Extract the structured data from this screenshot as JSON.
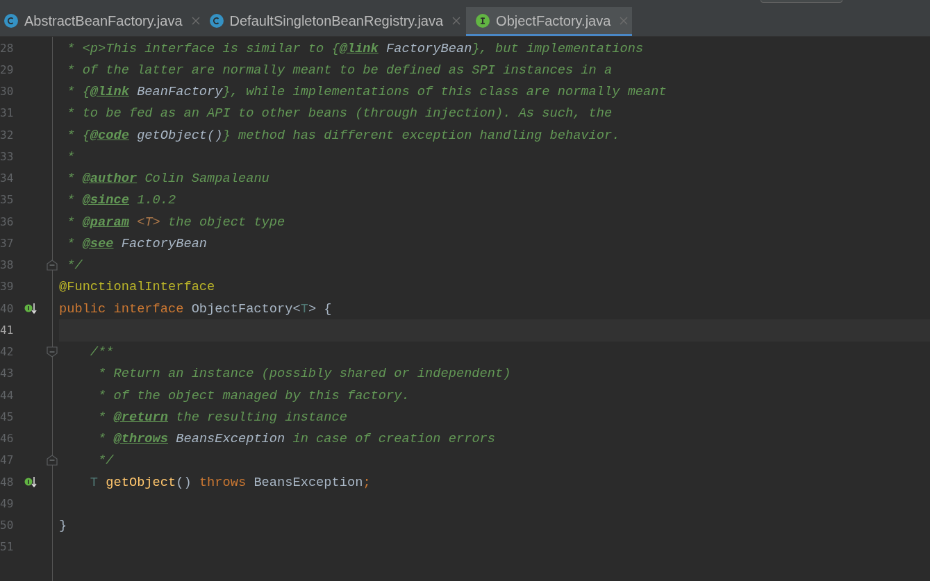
{
  "tabs": [
    {
      "label": "AbstractBeanFactory.java",
      "kind": "class",
      "selected": false
    },
    {
      "label": "DefaultSingletonBeanRegistry.java",
      "kind": "class",
      "selected": false
    },
    {
      "label": "ObjectFactory.java",
      "kind": "interface",
      "selected": true
    }
  ],
  "editor": {
    "lines": [
      {
        "number": "28",
        "current": false,
        "tokens": [
          {
            "kind": "comment",
            "text": " * <p>This interface is similar to {"
          },
          {
            "kind": "tag",
            "text": "@link"
          },
          {
            "kind": "ref",
            "text": " FactoryBean"
          },
          {
            "kind": "comment",
            "text": "}, but implementations"
          }
        ]
      },
      {
        "number": "29",
        "current": false,
        "tokens": [
          {
            "kind": "comment",
            "text": " * of the latter are normally meant to be defined as SPI instances in a"
          }
        ]
      },
      {
        "number": "30",
        "current": false,
        "tokens": [
          {
            "kind": "comment",
            "text": " * {"
          },
          {
            "kind": "tag",
            "text": "@link"
          },
          {
            "kind": "ref",
            "text": " BeanFactory"
          },
          {
            "kind": "comment",
            "text": "}, while implementations of this class are normally meant"
          }
        ]
      },
      {
        "number": "31",
        "current": false,
        "tokens": [
          {
            "kind": "comment",
            "text": " * to be fed as an API to other beans (through injection). As such, the"
          }
        ]
      },
      {
        "number": "32",
        "current": false,
        "tokens": [
          {
            "kind": "comment",
            "text": " * {"
          },
          {
            "kind": "tag",
            "text": "@code"
          },
          {
            "kind": "ref",
            "text": " getObject()"
          },
          {
            "kind": "comment",
            "text": "} method has different exception handling behavior."
          }
        ]
      },
      {
        "number": "33",
        "current": false,
        "tokens": [
          {
            "kind": "comment",
            "text": " *"
          }
        ]
      },
      {
        "number": "34",
        "current": false,
        "tokens": [
          {
            "kind": "comment",
            "text": " * "
          },
          {
            "kind": "tag",
            "text": "@author"
          },
          {
            "kind": "comment",
            "text": " Colin Sampaleanu"
          }
        ]
      },
      {
        "number": "35",
        "current": false,
        "tokens": [
          {
            "kind": "comment",
            "text": " * "
          },
          {
            "kind": "tag",
            "text": "@since"
          },
          {
            "kind": "comment",
            "text": " 1.0.2"
          }
        ]
      },
      {
        "number": "36",
        "current": false,
        "tokens": [
          {
            "kind": "comment",
            "text": " * "
          },
          {
            "kind": "tag",
            "text": "@param"
          },
          {
            "kind": "docparam",
            "text": " <T>"
          },
          {
            "kind": "comment",
            "text": " the object type"
          }
        ]
      },
      {
        "number": "37",
        "current": false,
        "tokens": [
          {
            "kind": "comment",
            "text": " * "
          },
          {
            "kind": "tag",
            "text": "@see"
          },
          {
            "kind": "ref",
            "text": " FactoryBean"
          }
        ]
      },
      {
        "number": "38",
        "current": false,
        "gutter": {
          "kind": "fold-end"
        },
        "tokens": [
          {
            "kind": "comment",
            "text": " */"
          }
        ]
      },
      {
        "number": "39",
        "current": false,
        "tokens": [
          {
            "kind": "annotation",
            "text": "@FunctionalInterface"
          }
        ]
      },
      {
        "number": "40",
        "current": false,
        "gutter": {
          "kind": "implemented"
        },
        "tokens": [
          {
            "kind": "keyword",
            "text": "public interface "
          },
          {
            "kind": "plain",
            "text": "ObjectFactory<"
          },
          {
            "kind": "typeparam",
            "text": "T"
          },
          {
            "kind": "plain",
            "text": "> {"
          }
        ]
      },
      {
        "number": "41",
        "current": true
      },
      {
        "number": "42",
        "current": false,
        "gutter": {
          "kind": "fold-start"
        },
        "tokens": [
          {
            "kind": "comment",
            "text": "    /**"
          }
        ]
      },
      {
        "number": "43",
        "current": false,
        "tokens": [
          {
            "kind": "comment",
            "text": "     * Return an instance (possibly shared or independent)"
          }
        ]
      },
      {
        "number": "44",
        "current": false,
        "tokens": [
          {
            "kind": "comment",
            "text": "     * of the object managed by this factory."
          }
        ]
      },
      {
        "number": "45",
        "current": false,
        "tokens": [
          {
            "kind": "comment",
            "text": "     * "
          },
          {
            "kind": "tag",
            "text": "@return"
          },
          {
            "kind": "comment",
            "text": " the resulting instance"
          }
        ]
      },
      {
        "number": "46",
        "current": false,
        "tokens": [
          {
            "kind": "comment",
            "text": "     * "
          },
          {
            "kind": "tag",
            "text": "@throws"
          },
          {
            "kind": "ref",
            "text": " BeansException"
          },
          {
            "kind": "comment",
            "text": " in case of creation errors"
          }
        ]
      },
      {
        "number": "47",
        "current": false,
        "gutter": {
          "kind": "fold-end"
        },
        "tokens": [
          {
            "kind": "comment",
            "text": "     */"
          }
        ]
      },
      {
        "number": "48",
        "current": false,
        "gutter": {
          "kind": "implemented"
        },
        "tokens": [
          {
            "kind": "typeparam",
            "text": "    T"
          },
          {
            "kind": "method",
            "text": " getObject"
          },
          {
            "kind": "plain",
            "text": "() "
          },
          {
            "kind": "keyword",
            "text": "throws "
          },
          {
            "kind": "plain",
            "text": "BeansException"
          },
          {
            "kind": "keyword",
            "text": ";"
          }
        ]
      },
      {
        "number": "49",
        "current": false
      },
      {
        "number": "50",
        "current": false,
        "tokens": [
          {
            "kind": "plain",
            "text": "}"
          }
        ]
      },
      {
        "number": "51",
        "current": false
      }
    ]
  }
}
